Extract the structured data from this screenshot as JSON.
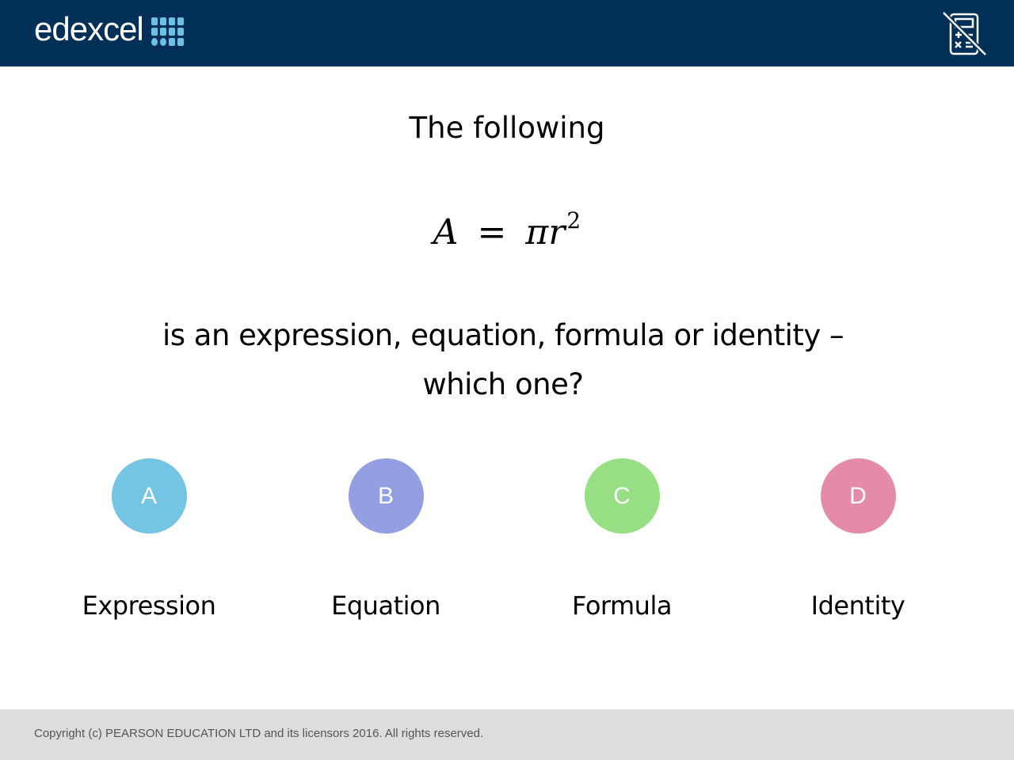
{
  "header": {
    "brand": "edexcel",
    "brand_color": "#003057",
    "accent_color": "#6cc0e5",
    "tool_icon": "no-calculator-icon"
  },
  "slide": {
    "intro": "The following",
    "formula": {
      "lhs": "A",
      "equals": "=",
      "pi": "π",
      "r": "r",
      "exponent": "2"
    },
    "question": "is an expression, equation, formula or identity – which one?"
  },
  "options": [
    {
      "letter": "A",
      "label": "Expression",
      "color": "#74c4e3"
    },
    {
      "letter": "B",
      "label": "Equation",
      "color": "#949fe3"
    },
    {
      "letter": "C",
      "label": "Formula",
      "color": "#97df85"
    },
    {
      "letter": "D",
      "label": "Identity",
      "color": "#e48ba7"
    }
  ],
  "footer": {
    "copyright": "Copyright (c) PEARSON EDUCATION LTD and its licensors 2016. All rights reserved."
  }
}
